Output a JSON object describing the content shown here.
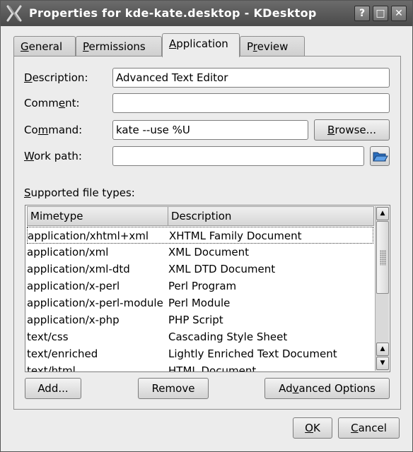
{
  "window": {
    "title": "Properties for kde-kate.desktop - KDesktop",
    "help_glyph": "?",
    "maximize_glyph": "□",
    "close_glyph": "✕"
  },
  "tabs": [
    {
      "label": "General",
      "mnemonic": "G",
      "rest": "eneral"
    },
    {
      "label": "Permissions",
      "mnemonic": "P",
      "rest": "ermissions"
    },
    {
      "label": "Application",
      "mnemonic": "A",
      "rest": "pplication",
      "active": true
    },
    {
      "label": "Preview",
      "pre": "P",
      "mnemonic": "r",
      "rest": "eview"
    }
  ],
  "form": {
    "description": {
      "label_pre": "",
      "mnemonic": "D",
      "label_post": "escription:",
      "value": "Advanced Text Editor"
    },
    "comment": {
      "label_pre": "Comm",
      "mnemonic": "e",
      "label_post": "nt:",
      "value": ""
    },
    "command": {
      "label_pre": "Co",
      "mnemonic": "m",
      "label_post": "mand:",
      "value": "kate --use %U"
    },
    "work_path": {
      "label_pre": "",
      "mnemonic": "W",
      "label_post": "ork path:",
      "value": ""
    },
    "browse_pre": "",
    "browse_mnemonic": "B",
    "browse_post": "rowse...",
    "folder_icon": "folder-open-icon"
  },
  "filetypes": {
    "label_pre": "",
    "label_mnemonic": "S",
    "label_post": "upported file types:",
    "columns": [
      "Mimetype",
      "Description"
    ],
    "rows": [
      {
        "mimetype": "application/xhtml+xml",
        "description": "XHTML Family Document",
        "selected": true
      },
      {
        "mimetype": "application/xml",
        "description": "XML Document"
      },
      {
        "mimetype": "application/xml-dtd",
        "description": "XML DTD Document"
      },
      {
        "mimetype": "application/x-perl",
        "description": "Perl Program"
      },
      {
        "mimetype": "application/x-perl-module",
        "description": "Perl Module"
      },
      {
        "mimetype": "application/x-php",
        "description": "PHP Script"
      },
      {
        "mimetype": "text/css",
        "description": "Cascading Style Sheet"
      },
      {
        "mimetype": "text/enriched",
        "description": "Lightly Enriched Text Document"
      },
      {
        "mimetype": "text/html",
        "description": "HTML Document"
      }
    ],
    "add_label": "Add...",
    "remove_label": "Remove",
    "advanced_pre": "Ad",
    "advanced_mnemonic": "v",
    "advanced_post": "anced Options"
  },
  "footer": {
    "ok_mnemonic": "O",
    "ok_post": "K",
    "cancel_mnemonic": "C",
    "cancel_post": "ancel"
  },
  "colors": {
    "titlebar": "#4a4a4a",
    "dialog_bg": "#ececec",
    "selection_focus": "#333333"
  }
}
